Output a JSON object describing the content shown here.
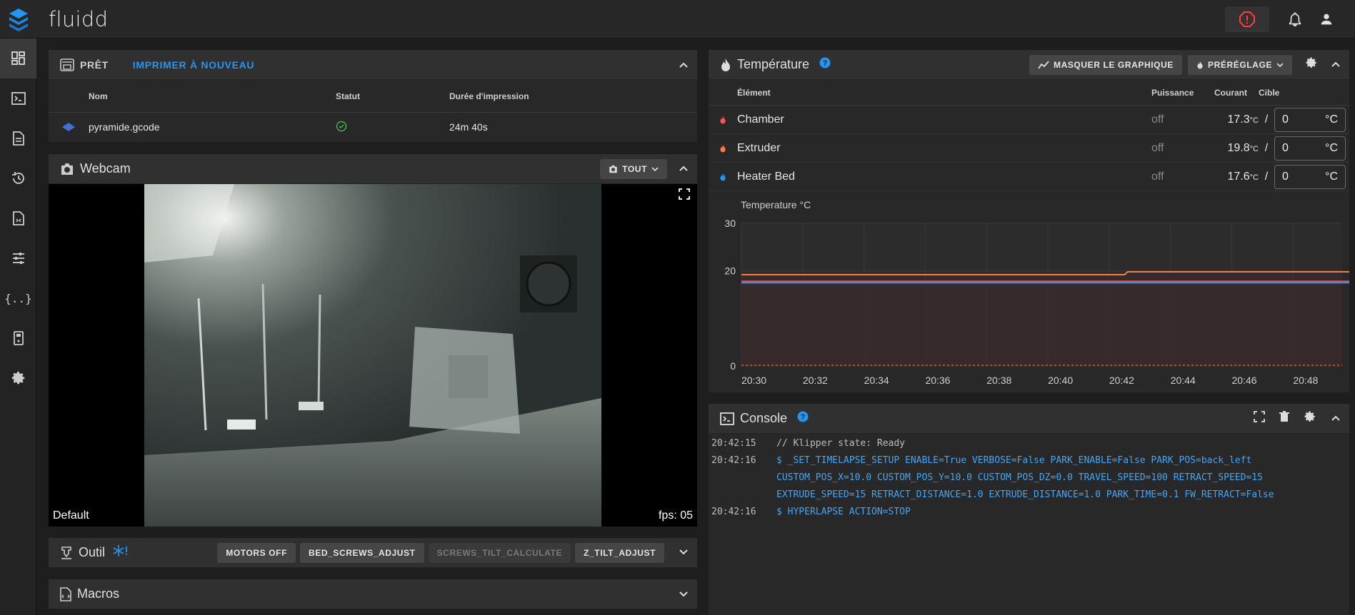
{
  "app": {
    "title": "fluidd"
  },
  "job": {
    "status_label": "PRÊT",
    "reprint_label": "IMPRIMER À NOUVEAU",
    "columns": [
      "Nom",
      "Statut",
      "Durée d'impression"
    ],
    "file": {
      "name": "pyramide.gcode",
      "duration": "24m 40s"
    }
  },
  "webcam": {
    "title": "Webcam",
    "camera_select": "TOUT",
    "camera_name": "Default",
    "fps": "fps: 05"
  },
  "tool": {
    "title": "Outil",
    "buttons": [
      "MOTORS OFF",
      "BED_SCREWS_ADJUST",
      "SCREWS_TILT_CALCULATE",
      "Z_TILT_ADJUST"
    ]
  },
  "macros": {
    "title": "Macros"
  },
  "temperature": {
    "title": "Température",
    "hide_chart_label": "MASQUER LE GRAPHIQUE",
    "preset_label": "PRÉRÉGLAGE",
    "columns": [
      "Élément",
      "Puissance",
      "Courant",
      "Cible"
    ],
    "slash": "/",
    "rows": [
      {
        "name": "Chamber",
        "power": "off",
        "current": "17.3",
        "unit": "°C",
        "target": "0",
        "target_unit": "°C",
        "color": "#ff5252"
      },
      {
        "name": "Extruder",
        "power": "off",
        "current": "19.8",
        "unit": "°C",
        "target": "0",
        "target_unit": "°C",
        "color": "#ff7a45"
      },
      {
        "name": "Heater Bed",
        "power": "off",
        "current": "17.6",
        "unit": "°C",
        "target": "0",
        "target_unit": "°C",
        "color": "#2196f3"
      }
    ]
  },
  "chart_data": {
    "type": "line",
    "title": "Temperature °C",
    "ylim": [
      0,
      30
    ],
    "yticks": [
      0,
      20,
      30
    ],
    "x_ticks": [
      "20:30",
      "20:32",
      "20:34",
      "20:36",
      "20:38",
      "20:40",
      "20:42",
      "20:44",
      "20:46",
      "20:48"
    ],
    "series": [
      {
        "name": "Extruder",
        "color": "#ff7a45",
        "values_note": "",
        "x": [
          0,
          12.5,
          12.6,
          20
        ],
        "y": [
          19.2,
          19.2,
          19.8,
          19.8
        ]
      },
      {
        "name": "Chamber",
        "color": "#ff5252",
        "x": [
          0,
          20
        ],
        "y": [
          17.8,
          17.8
        ]
      },
      {
        "name": "Heater Bed",
        "color": "#2196f3",
        "x": [
          0,
          20
        ],
        "y": [
          17.5,
          17.5
        ]
      }
    ],
    "grid": true
  },
  "console": {
    "title": "Console",
    "lines": [
      {
        "time": "20:42:15",
        "text": "// Klipper state: Ready",
        "cmd": false
      },
      {
        "time": "20:42:16",
        "text": "$ _SET_TIMELAPSE_SETUP ENABLE=True VERBOSE=False PARK_ENABLE=False PARK_POS=back_left CUSTOM_POS_X=10.0 CUSTOM_POS_Y=10.0 CUSTOM_POS_DZ=0.0 TRAVEL_SPEED=100 RETRACT_SPEED=15 EXTRUDE_SPEED=15 RETRACT_DISTANCE=1.0 EXTRUDE_DISTANCE=1.0 PARK_TIME=0.1 FW_RETRACT=False",
        "cmd": true
      },
      {
        "time": "20:42:16",
        "text": "$ HYPERLAPSE ACTION=STOP",
        "cmd": true
      }
    ]
  },
  "colors": {
    "accent": "#2196f3",
    "estop": "#ff3b3b"
  }
}
